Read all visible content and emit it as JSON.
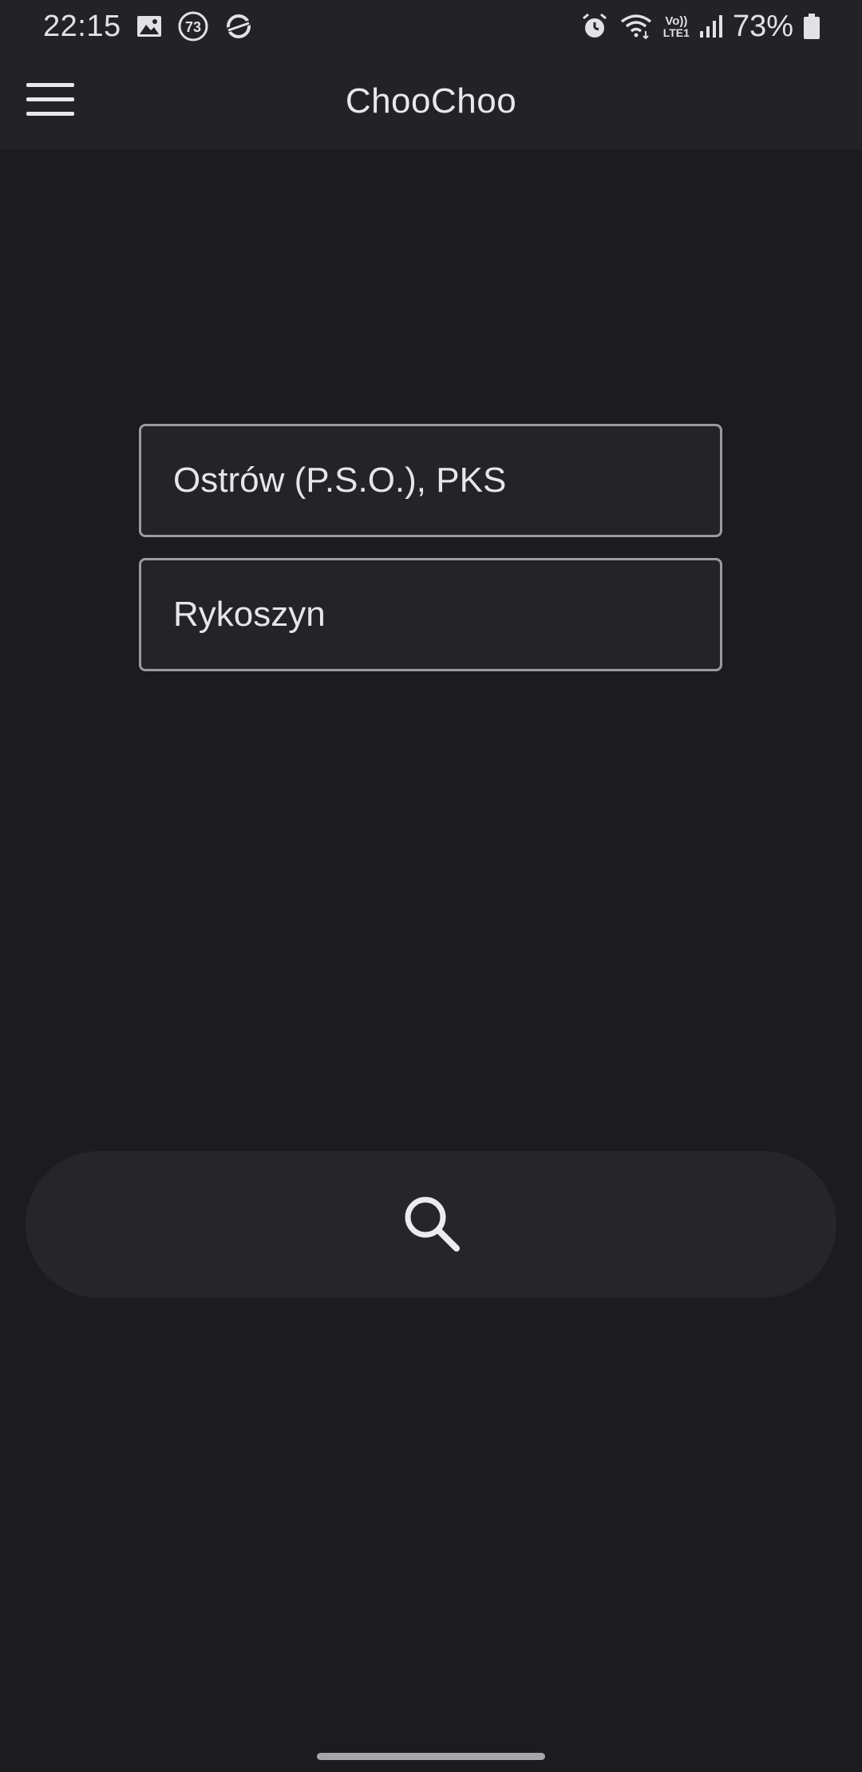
{
  "status_bar": {
    "time": "22:15",
    "left_icons": [
      "gallery-icon",
      "notification-count-icon",
      "sync-icon"
    ],
    "notification_count": "73",
    "right_icons": [
      "alarm-icon",
      "wifi-icon",
      "volte-icon",
      "signal-icon",
      "battery-icon"
    ],
    "volte_top": "Vo))",
    "volte_bottom": "LTE1",
    "battery_percent": "73%"
  },
  "app_bar": {
    "menu_icon": "hamburger-menu-icon",
    "title": "ChooChoo"
  },
  "search_form": {
    "from_station": "Ostrów (P.S.O.), PKS",
    "to_station": "Rykoszyn",
    "search_icon": "search-icon"
  },
  "colors": {
    "background": "#1c1b20",
    "bar": "#222227",
    "field_border": "#9a9aa0",
    "text": "#e6e6ea"
  }
}
